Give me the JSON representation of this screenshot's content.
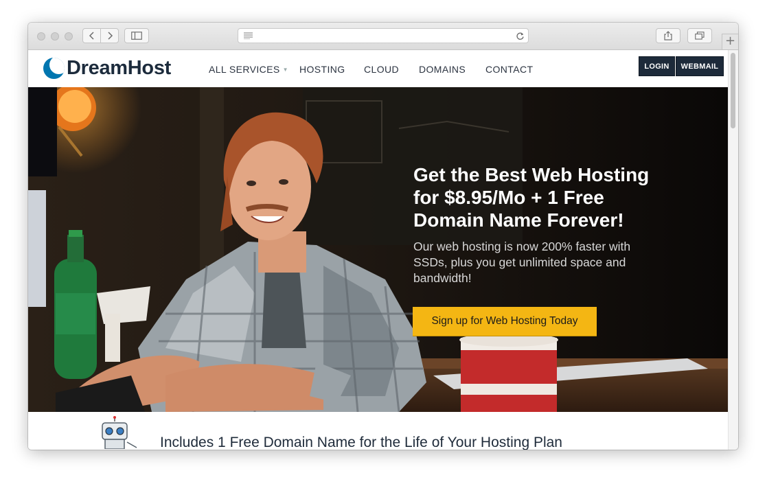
{
  "site": {
    "logo_text": "DreamHost"
  },
  "nav": {
    "items": [
      {
        "label": "ALL SERVICES"
      },
      {
        "label": "HOSTING"
      },
      {
        "label": "CLOUD"
      },
      {
        "label": "DOMAINS"
      },
      {
        "label": "CONTACT"
      }
    ],
    "login_label": "LOGIN",
    "webmail_label": "WEBMAIL"
  },
  "hero": {
    "title_lines": [
      "Get the Best Web Hosting",
      "for $8.95/Mo + 1 Free",
      "Domain Name Forever!"
    ],
    "subtitle_lines": [
      "Our web hosting is now 200% faster with",
      "SSDs, plus you get unlimited space and",
      "bandwidth!"
    ],
    "cta_label": "Sign up for Web Hosting Today"
  },
  "section": {
    "title": "Includes 1 Free Domain Name for the Life of Your Hosting Plan"
  },
  "icons": {
    "back": "chevron-left-icon",
    "forward": "chevron-right-icon",
    "sidebar": "sidebar-icon",
    "reader": "reader-icon",
    "reload": "reload-icon",
    "share": "share-icon",
    "tabs": "tabs-icon",
    "new_tab": "plus-icon",
    "dropdown": "caret-down-icon"
  },
  "colors": {
    "brand_blue": "#0076b0",
    "navy": "#1d2a3a",
    "cta_yellow": "#f4b613"
  }
}
